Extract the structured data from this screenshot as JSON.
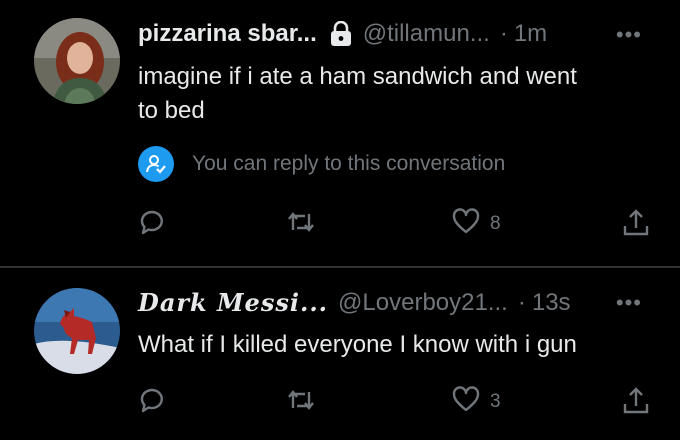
{
  "tweets": [
    {
      "display_name": "pizzarina sbar...",
      "handle": "@tillamun...",
      "time": "1m",
      "separator": "·",
      "more": "•••",
      "text_lines": [
        "imagine if i ate a ham sandwich and went",
        "to bed"
      ],
      "reply_notice": "You can reply to this conversation",
      "likes": "8",
      "icons": [
        "lock-icon",
        "reply-icon",
        "retweet-icon",
        "like-icon",
        "share-icon"
      ]
    },
    {
      "display_name": "Dark Messi...",
      "handle": "@Loverboy21...",
      "time": "13s",
      "separator": "·",
      "more": "•••",
      "text_lines": [
        "What if I killed everyone I know with i gun"
      ],
      "likes": "3",
      "icons": [
        "reply-icon",
        "retweet-icon",
        "like-icon",
        "share-icon"
      ]
    }
  ],
  "colors": {
    "background": "#000000",
    "primary_text": "#e7e9ea",
    "secondary_text": "#71767b",
    "accent": "#1d9bf0",
    "divider": "#2f3336"
  }
}
